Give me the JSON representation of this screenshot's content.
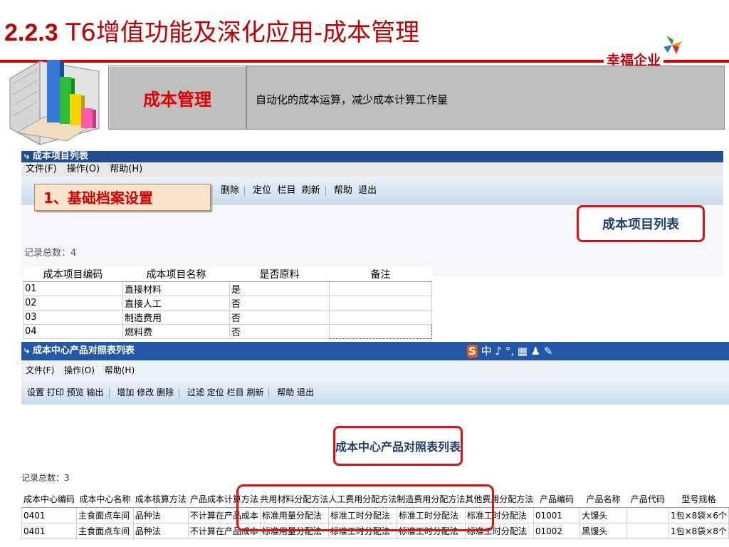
{
  "slide": {
    "title_num": "2.2.3",
    "title_text": "T6增值功能及深化应用-成本管理",
    "brand": "幸福企业",
    "header_label": "成本管理",
    "header_desc": "自动化的成本运算，减少成本计算工作量",
    "section_label": "1、基础档案设置"
  },
  "colors": {
    "accent_red": "#d40000",
    "titlebar_blue": "#1f4d8e",
    "header_gray": "#bebebe"
  },
  "window1": {
    "title": "成本项目列表",
    "menu": [
      "文件(F)",
      "操作(O)",
      "帮助(H)"
    ],
    "toolbar": [
      "删除",
      "定位",
      "栏目",
      "刷新",
      "帮助",
      "退出"
    ],
    "heading": "成本项目列表",
    "record_count": "记录总数：4",
    "columns": [
      "成本项目编码",
      "成本项目名称",
      "是否原料",
      "备注"
    ],
    "rows": [
      [
        "01",
        "直接材料",
        "是",
        ""
      ],
      [
        "02",
        "直接人工",
        "否",
        ""
      ],
      [
        "03",
        "制造费用",
        "否",
        ""
      ],
      [
        "04",
        "燃料费",
        "否",
        ""
      ]
    ]
  },
  "window2": {
    "title": "成本中心产品对照表列表",
    "ime": "中 ♪ °, ▦ ♟ ✎",
    "ime_s": "S",
    "menu": [
      "文件(F)",
      "操作(O)",
      "帮助(H)"
    ],
    "toolbar_groups": [
      [
        "设置",
        "打印",
        "预览",
        "输出"
      ],
      [
        "增加",
        "修改",
        "删除"
      ],
      [
        "过滤",
        "定位",
        "栏目",
        "刷新"
      ],
      [
        "帮助",
        "退出"
      ]
    ],
    "heading": "成本中心产品对照表列表",
    "record_count": "记录总数：3",
    "columns": [
      "成本中心编码",
      "成本中心名称",
      "成本核算方法",
      "产品成本计算方法",
      "共用材料分配方法",
      "人工费用分配方法",
      "制造费用分配方法",
      "其他费用分配方法",
      "产品编码",
      "产品名称",
      "产品代码",
      "型号规格"
    ],
    "rows": [
      [
        "0401",
        "主食面点车间",
        "品种法",
        "不计算在产品成本",
        "标准用量分配法",
        "标准工时分配法",
        "标准工时分配法",
        "标准工时分配法",
        "01001",
        "大馒头",
        "",
        "1包×8袋×6个"
      ],
      [
        "0401",
        "主食面点车间",
        "品种法",
        "不计算在产品成本",
        "标准用量分配法",
        "标准工时分配法",
        "标准工时分配法",
        "标准工时分配法",
        "01002",
        "黑馒头",
        "",
        "1包×8袋×8个"
      ]
    ]
  }
}
